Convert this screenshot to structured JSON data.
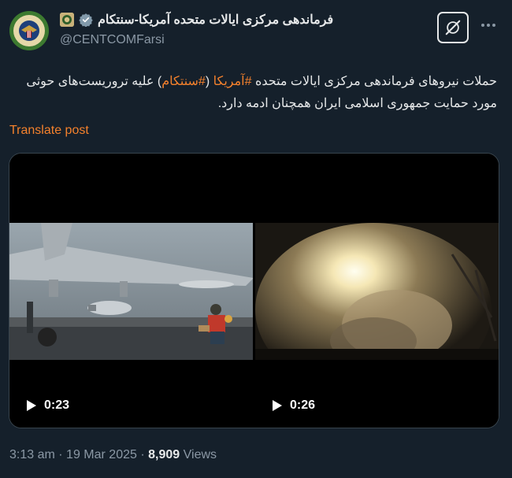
{
  "account": {
    "display_name": "فرماندهی مرکزی ایالات متحده آمریکا-سنتکام",
    "handle": "@CENTCOMFarsi",
    "avatar_text": "UNITED STATES CENTRAL COMMAND"
  },
  "tweet": {
    "text_before": "حملات نیروهای فرماندهی مرکزی ایالات متحده ",
    "hashtag1": "#آمریکا",
    "text_mid1": " (",
    "hashtag2": "#سنتکام",
    "text_mid2": ") علیه تروریست‌های حوثی مورد حمایت جمهوری اسلامی ایران همچنان ادمه دارد."
  },
  "translate_label": "Translate post",
  "media": {
    "videos": [
      {
        "duration": "0:23"
      },
      {
        "duration": "0:26"
      }
    ]
  },
  "meta": {
    "time": "3:13 am",
    "date": "19 Mar 2025",
    "views_count": "8,909",
    "views_label": "Views"
  },
  "colors": {
    "background": "#15202b",
    "accent": "#f4812c",
    "muted": "#8b98a5",
    "text": "#e7e9ea"
  },
  "icons": [
    "verified-badge-icon",
    "affiliate-badge-icon",
    "grok-icon",
    "more-icon",
    "play-icon"
  ]
}
